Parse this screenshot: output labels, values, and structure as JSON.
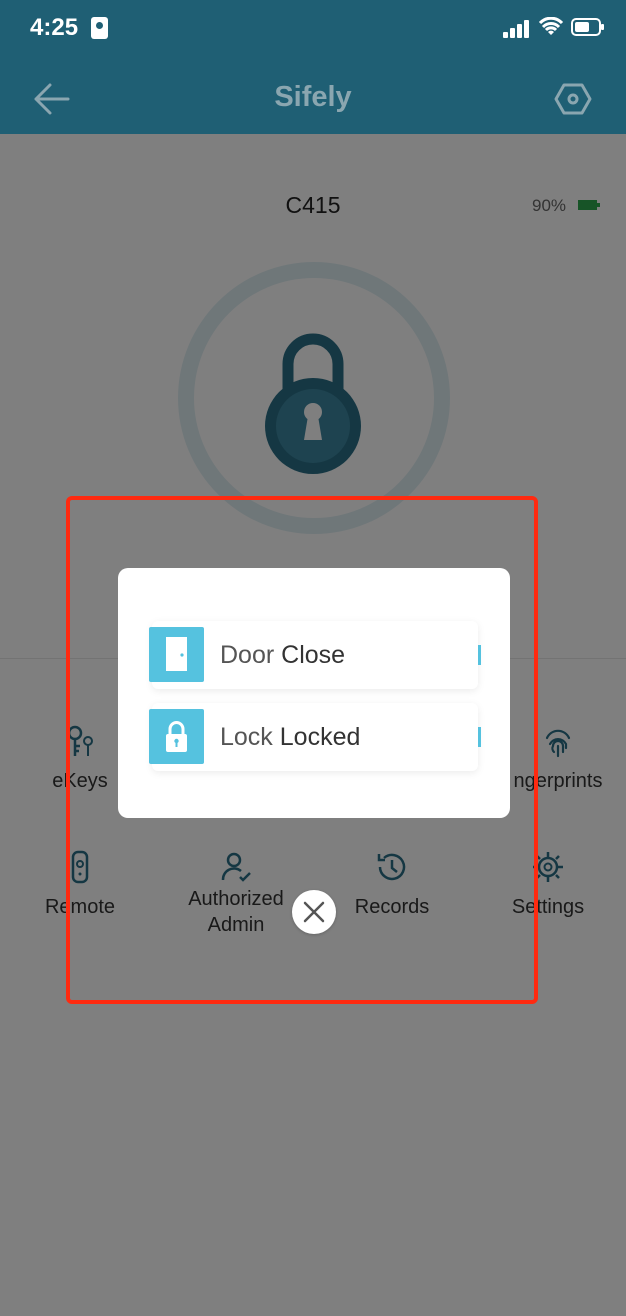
{
  "status_bar": {
    "time": "4:25"
  },
  "header": {
    "title": "Sifely"
  },
  "lock": {
    "name": "C415",
    "battery": "90%"
  },
  "grid": {
    "ekeys": "eKeys",
    "fingerprints": "ngerprints",
    "remote": "Remote",
    "authorized_line1": "Authorized",
    "authorized_line2": "Admin",
    "records": "Records",
    "settings": "Settings"
  },
  "modal": {
    "rows": [
      {
        "label": "Door",
        "value": "Close",
        "icon": "door-icon"
      },
      {
        "label": "Lock",
        "value": "Locked",
        "icon": "padlock-icon"
      }
    ]
  },
  "colors": {
    "header": "#1f5f74",
    "accent": "#55c2df",
    "lock_dark": "#2a6f86",
    "highlight": "#ff2a10"
  }
}
